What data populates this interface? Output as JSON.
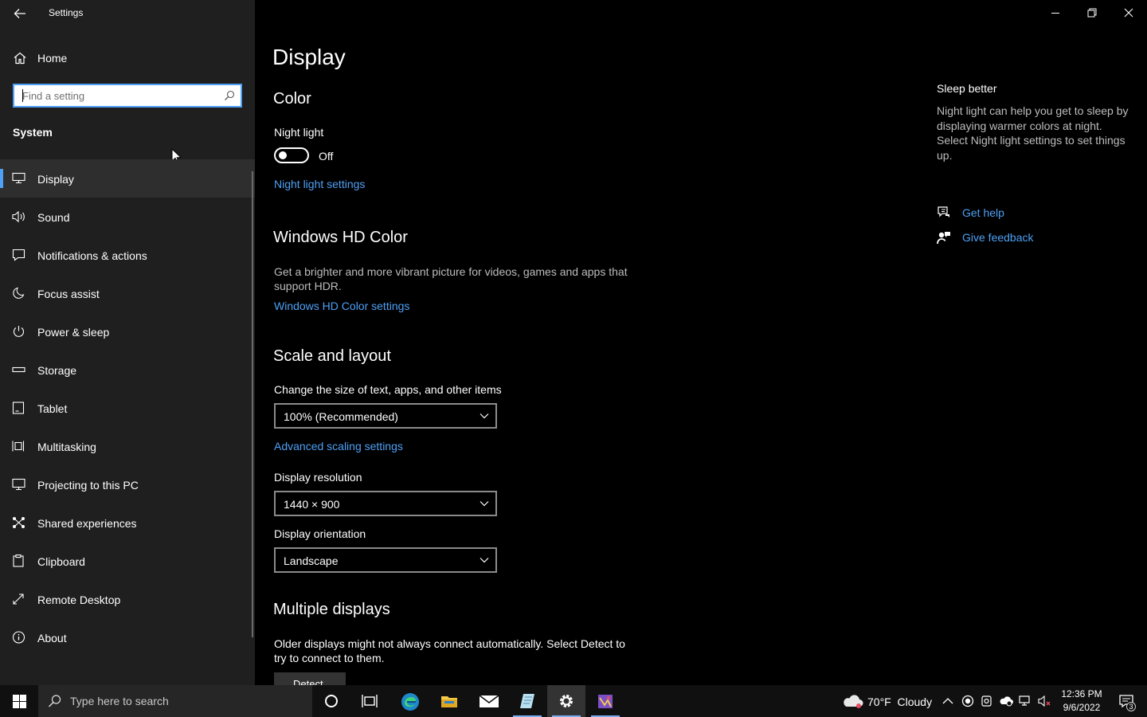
{
  "window": {
    "title": "Settings"
  },
  "sidebar": {
    "home_label": "Home",
    "search_placeholder": "Find a setting",
    "section_title": "System",
    "items": [
      {
        "label": "Display",
        "icon": "display-icon"
      },
      {
        "label": "Sound",
        "icon": "speaker-icon"
      },
      {
        "label": "Notifications & actions",
        "icon": "notification-icon"
      },
      {
        "label": "Focus assist",
        "icon": "moon-icon"
      },
      {
        "label": "Power & sleep",
        "icon": "power-icon"
      },
      {
        "label": "Storage",
        "icon": "storage-icon"
      },
      {
        "label": "Tablet",
        "icon": "tablet-icon"
      },
      {
        "label": "Multitasking",
        "icon": "multitasking-icon"
      },
      {
        "label": "Projecting to this PC",
        "icon": "projecting-icon"
      },
      {
        "label": "Shared experiences",
        "icon": "shared-icon"
      },
      {
        "label": "Clipboard",
        "icon": "clipboard-icon"
      },
      {
        "label": "Remote Desktop",
        "icon": "remote-desktop-icon"
      },
      {
        "label": "About",
        "icon": "info-icon"
      }
    ],
    "active_item": "Display"
  },
  "main": {
    "page_title": "Display",
    "color": {
      "heading": "Color",
      "night_light_label": "Night light",
      "night_light_state": "Off",
      "night_light_on": false,
      "night_light_settings_link": "Night light settings"
    },
    "hdr": {
      "heading": "Windows HD Color",
      "description": "Get a brighter and more vibrant picture for videos, games and apps that support HDR.",
      "link": "Windows HD Color settings"
    },
    "scale": {
      "heading": "Scale and layout",
      "size_label": "Change the size of text, apps, and other items",
      "size_value": "100% (Recommended)",
      "advanced_link": "Advanced scaling settings",
      "resolution_label": "Display resolution",
      "resolution_value": "1440 × 900",
      "orientation_label": "Display orientation",
      "orientation_value": "Landscape"
    },
    "multiple": {
      "heading": "Multiple displays",
      "description": "Older displays might not always connect automatically. Select Detect to try to connect to them.",
      "detect_label": "Detect"
    }
  },
  "aside": {
    "title": "Sleep better",
    "text": "Night light can help you get to sleep by displaying warmer colors at night. Select Night light settings to set things up.",
    "get_help": "Get help",
    "give_feedback": "Give feedback"
  },
  "taskbar": {
    "search_placeholder": "Type here to search",
    "apps": [
      "cortana-icon",
      "task-view-icon",
      "edge-icon",
      "file-explorer-icon",
      "mail-icon",
      "notepad-app-icon",
      "settings-gear-icon",
      "paint-app-icon"
    ],
    "weather": {
      "temp": "70°F",
      "condition": "Cloudy"
    },
    "clock": {
      "time": "12:36 PM",
      "date": "9/6/2022"
    },
    "notification_count": "3"
  },
  "colors": {
    "accent": "#4ea0f5",
    "sidebar_bg": "#1f1f1f",
    "main_bg": "#000000",
    "taskbar_bg": "#101010"
  }
}
